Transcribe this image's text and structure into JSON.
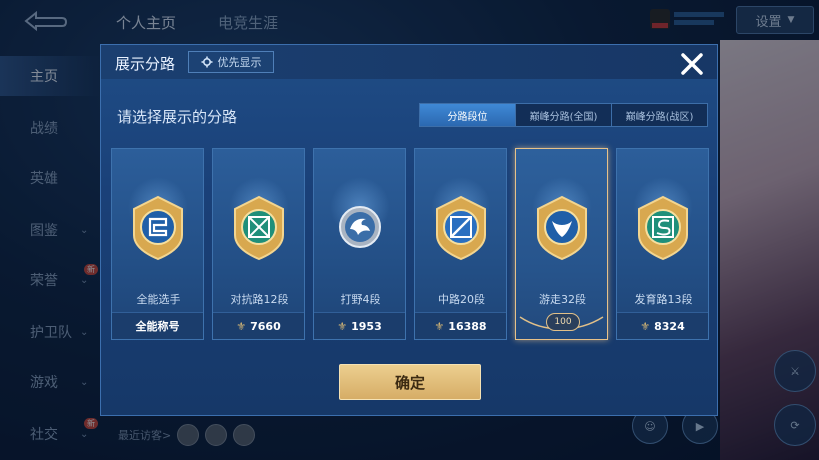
{
  "top": {
    "tabs": [
      {
        "label": "个人主页"
      },
      {
        "label": "电竞生涯"
      }
    ],
    "settings_label": "设置"
  },
  "side_nav": {
    "items": [
      {
        "label": "主页",
        "active": true
      },
      {
        "label": "战绩"
      },
      {
        "label": "英雄"
      },
      {
        "label": "图鉴"
      },
      {
        "label": "荣誉",
        "new": true
      },
      {
        "label": "护卫队"
      },
      {
        "label": "游戏"
      },
      {
        "label": "社交",
        "new": true
      }
    ],
    "new_badge": "新"
  },
  "visitors_label": "最近访客>",
  "modal": {
    "title": "展示分路",
    "priority_label": "优先显示",
    "subtitle": "请选择展示的分路",
    "tabs": [
      {
        "label": "分路段位",
        "active": true
      },
      {
        "label": "巅峰分路(全国)"
      },
      {
        "label": "巅峰分路(战区)"
      }
    ],
    "cards": [
      {
        "name": "全能选手",
        "footer": "全能称号",
        "icon": "all-round-emblem-icon",
        "has_coin": false
      },
      {
        "name": "对抗路12段",
        "footer": "7660",
        "icon": "clash-lane-emblem-icon",
        "has_coin": true
      },
      {
        "name": "打野4段",
        "footer": "1953",
        "icon": "jungle-emblem-icon",
        "has_coin": true
      },
      {
        "name": "中路20段",
        "footer": "16388",
        "icon": "mid-lane-emblem-icon",
        "has_coin": true
      },
      {
        "name": "游走32段",
        "footer": "100",
        "icon": "roam-emblem-icon",
        "has_coin": false,
        "selected": true
      },
      {
        "name": "发育路13段",
        "footer": "8324",
        "icon": "farm-lane-emblem-icon",
        "has_coin": true
      }
    ],
    "confirm_label": "确定"
  },
  "colors": {
    "accent_gold": "#e6c28a",
    "tab_active": "#3f89d6",
    "panel": "#1f4d86"
  }
}
